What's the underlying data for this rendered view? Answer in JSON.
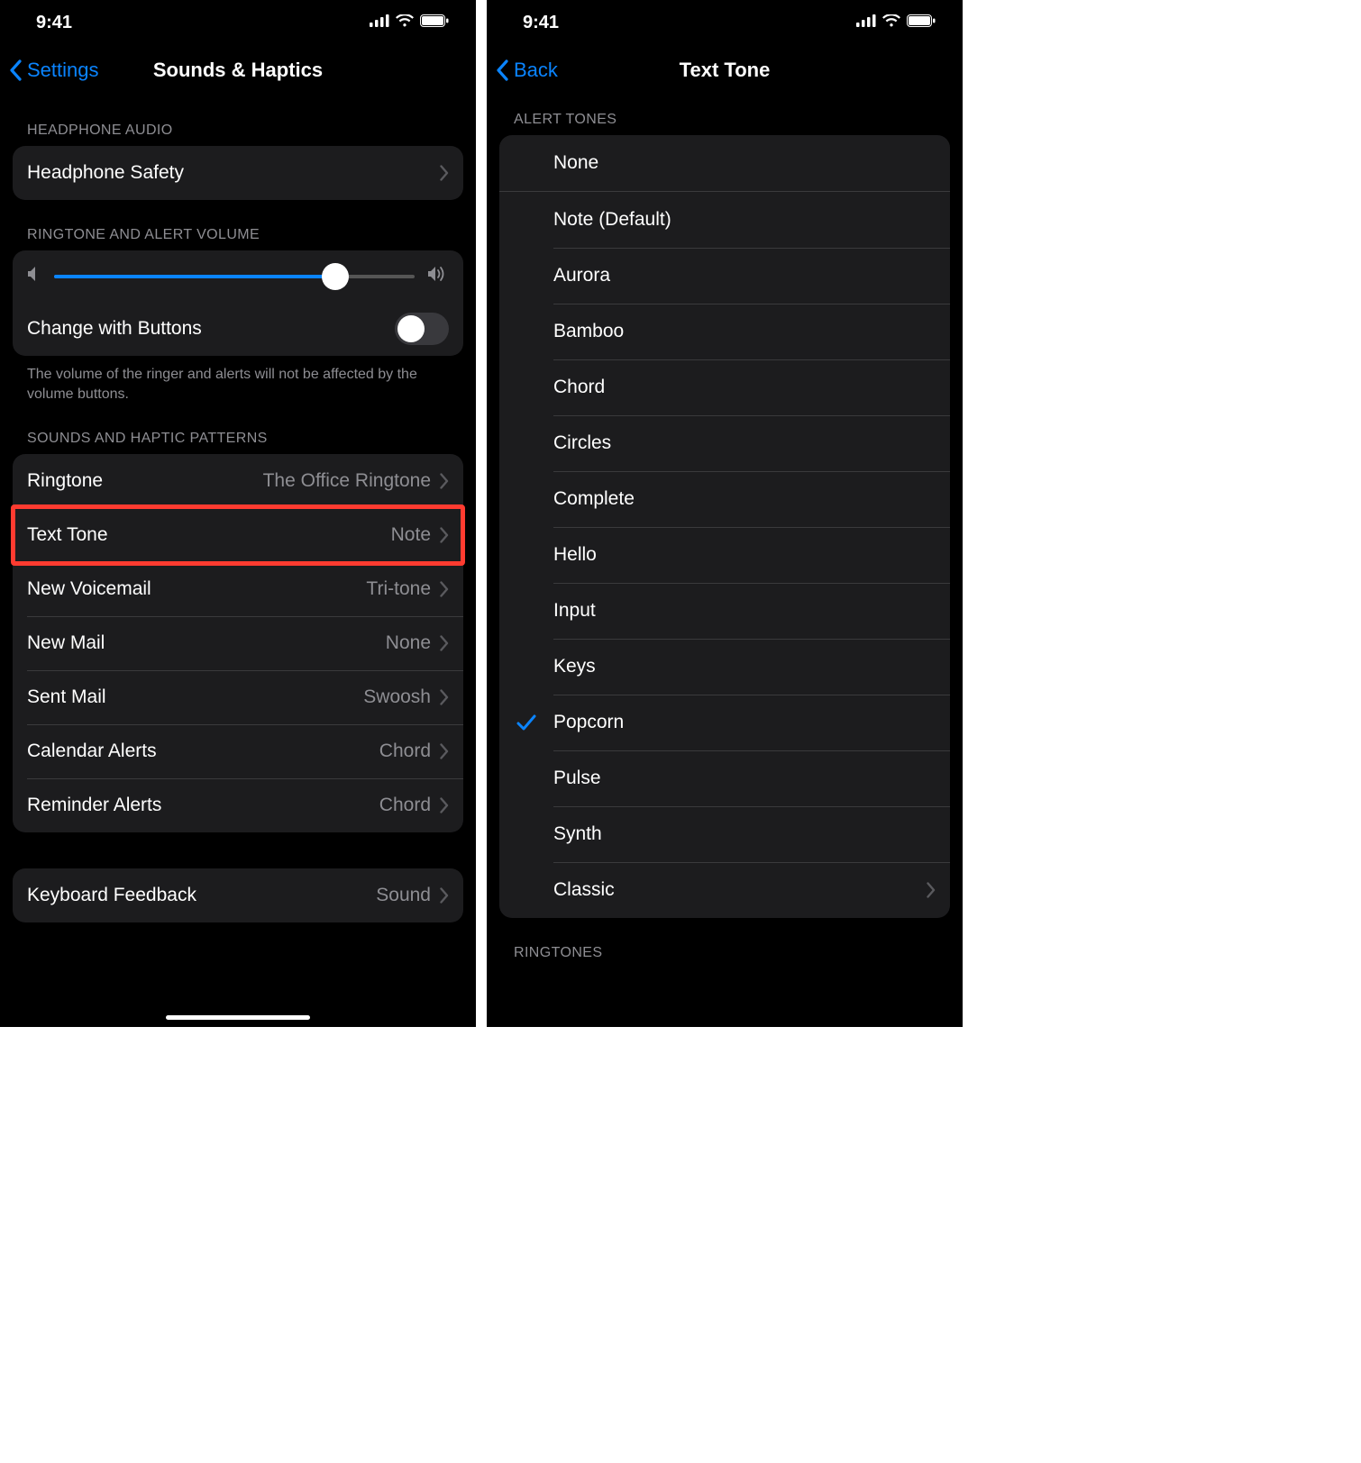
{
  "status": {
    "time": "9:41"
  },
  "left": {
    "nav": {
      "back": "Settings",
      "title": "Sounds & Haptics"
    },
    "sections": {
      "headphone": {
        "header": "HEADPHONE AUDIO",
        "safety": "Headphone Safety"
      },
      "volume": {
        "header": "RINGTONE AND ALERT VOLUME",
        "slider_percent": 78,
        "change_with_buttons": {
          "label": "Change with Buttons",
          "on": false
        },
        "footer": "The volume of the ringer and alerts will not be affected by the volume buttons."
      },
      "patterns": {
        "header": "SOUNDS AND HAPTIC PATTERNS",
        "items": [
          {
            "label": "Ringtone",
            "value": "The Office Ringtone"
          },
          {
            "label": "Text Tone",
            "value": "Note",
            "highlighted": true
          },
          {
            "label": "New Voicemail",
            "value": "Tri-tone"
          },
          {
            "label": "New Mail",
            "value": "None"
          },
          {
            "label": "Sent Mail",
            "value": "Swoosh"
          },
          {
            "label": "Calendar Alerts",
            "value": "Chord"
          },
          {
            "label": "Reminder Alerts",
            "value": "Chord"
          }
        ]
      },
      "keyboard": {
        "label": "Keyboard Feedback",
        "value": "Sound"
      }
    }
  },
  "right": {
    "nav": {
      "back": "Back",
      "title": "Text Tone"
    },
    "alert_tones": {
      "header": "ALERT TONES",
      "items": [
        {
          "label": "None"
        },
        {
          "label": "Note (Default)"
        },
        {
          "label": "Aurora"
        },
        {
          "label": "Bamboo"
        },
        {
          "label": "Chord"
        },
        {
          "label": "Circles"
        },
        {
          "label": "Complete"
        },
        {
          "label": "Hello"
        },
        {
          "label": "Input"
        },
        {
          "label": "Keys"
        },
        {
          "label": "Popcorn",
          "selected": true
        },
        {
          "label": "Pulse"
        },
        {
          "label": "Synth"
        },
        {
          "label": "Classic",
          "disclosure": true
        }
      ]
    },
    "ringtones": {
      "header": "RINGTONES"
    }
  }
}
